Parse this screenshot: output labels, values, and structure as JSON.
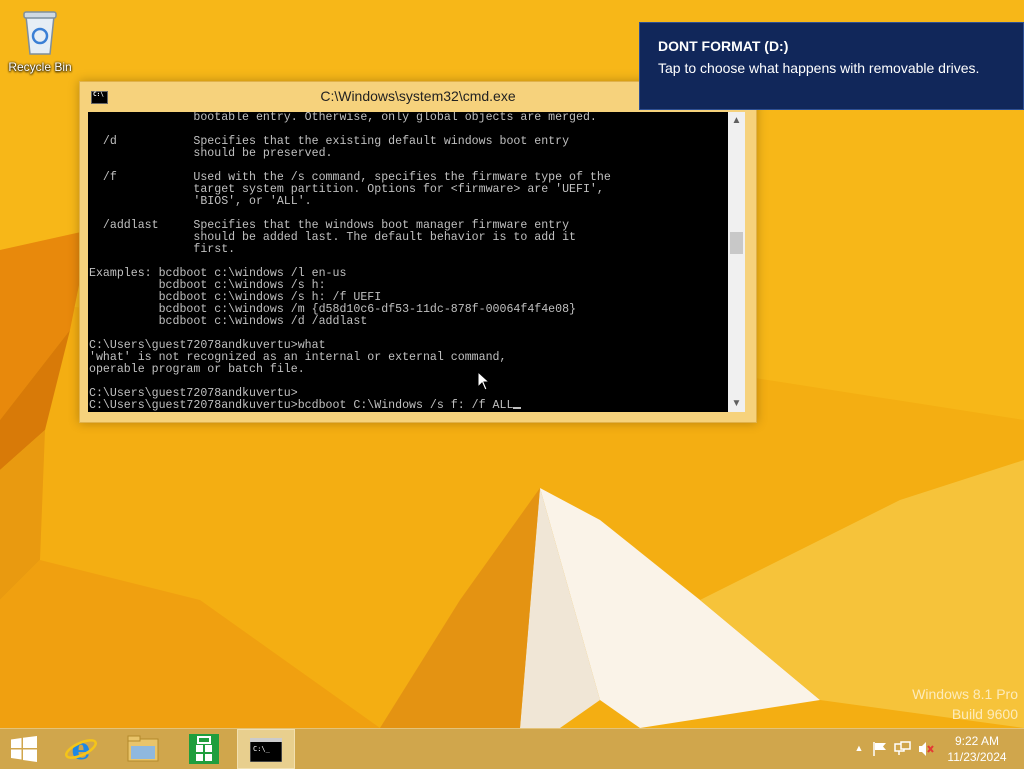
{
  "desktop": {
    "icons": [
      {
        "label": "Recycle Bin",
        "icon": "recycle-bin-icon"
      }
    ]
  },
  "watermark": {
    "line1": "Windows 8.1 Pro",
    "line2": "Build 9600"
  },
  "notification": {
    "title": "DONT FORMAT (D:)",
    "body": "Tap to choose what happens with removable drives."
  },
  "cmd_window": {
    "title": "C:\\Windows\\system32\\cmd.exe",
    "console_lines": [
      "               bootable entry. Otherwise, only global objects are merged.",
      "",
      "  /d           Specifies that the existing default windows boot entry",
      "               should be preserved.",
      "",
      "  /f           Used with the /s command, specifies the firmware type of the",
      "               target system partition. Options for <firmware> are 'UEFI',",
      "               'BIOS', or 'ALL'.",
      "",
      "  /addlast     Specifies that the windows boot manager firmware entry",
      "               should be added last. The default behavior is to add it",
      "               first.",
      "",
      "Examples: bcdboot c:\\windows /l en-us",
      "          bcdboot c:\\windows /s h:",
      "          bcdboot c:\\windows /s h: /f UEFI",
      "          bcdboot c:\\windows /m {d58d10c6-df53-11dc-878f-00064f4f4e08}",
      "          bcdboot c:\\windows /d /addlast",
      "",
      "C:\\Users\\guest72078andkuvertu>what",
      "'what' is not recognized as an internal or external command,",
      "operable program or batch file.",
      "",
      "C:\\Users\\guest72078andkuvertu>",
      "C:\\Users\\guest72078andkuvertu>bcdboot C:\\Windows /s f: /f ALL"
    ],
    "colors": {
      "console_bg": "#000000",
      "console_fg": "#c0c0c0",
      "frame": "#f6d27c"
    }
  },
  "taskbar": {
    "buttons": [
      {
        "name": "start-button",
        "icon": "windows-logo-icon"
      },
      {
        "name": "internet-explorer-button",
        "icon": "internet-explorer-icon"
      },
      {
        "name": "file-explorer-button",
        "icon": "folder-icon"
      },
      {
        "name": "store-button",
        "icon": "store-icon"
      },
      {
        "name": "cmd-taskbar-button",
        "icon": "cmd-icon",
        "active": true
      }
    ],
    "tray": {
      "icons": [
        "show-hidden-icons-chevron-icon",
        "action-center-flag-icon",
        "network-icon",
        "volume-muted-icon"
      ],
      "time": "9:22 AM",
      "date": "11/23/2024"
    }
  },
  "colors": {
    "wallpaper": "#f2a70c",
    "taskbar": "#d0a64c",
    "notification": "#11275a"
  }
}
